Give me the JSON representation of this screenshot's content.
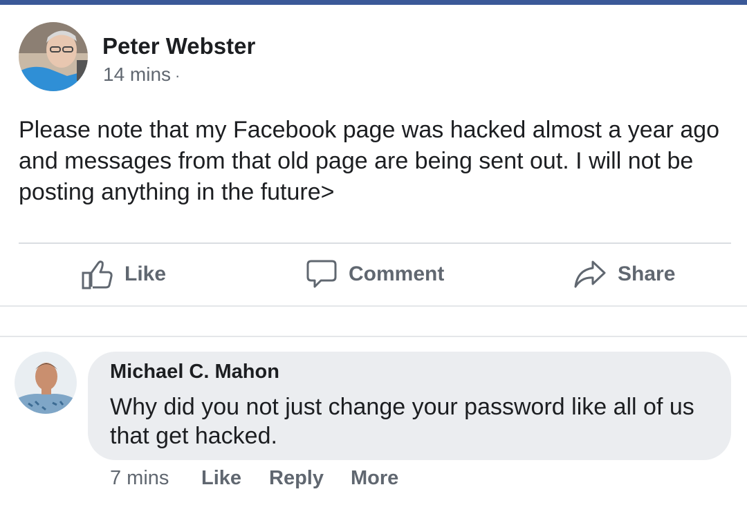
{
  "post": {
    "author": "Peter Webster",
    "timestamp": "14 mins",
    "separator": "·",
    "body": "Please note that my Facebook page was hacked almost a year ago and messages from that old page are being sent out. I will not be posting anything in the future>"
  },
  "actions": {
    "like_label": "Like",
    "comment_label": "Comment",
    "share_label": "Share"
  },
  "comment": {
    "author": "Michael C. Mahon",
    "text": "Why did you not just change your password like all of us that get hacked.",
    "timestamp": "7 mins",
    "like_label": "Like",
    "reply_label": "Reply",
    "more_label": "More"
  },
  "colors": {
    "brand_bar": "#3b5998",
    "secondary_text": "#606770",
    "primary_text": "#1c1e21",
    "bubble_bg": "#ebedf0"
  }
}
